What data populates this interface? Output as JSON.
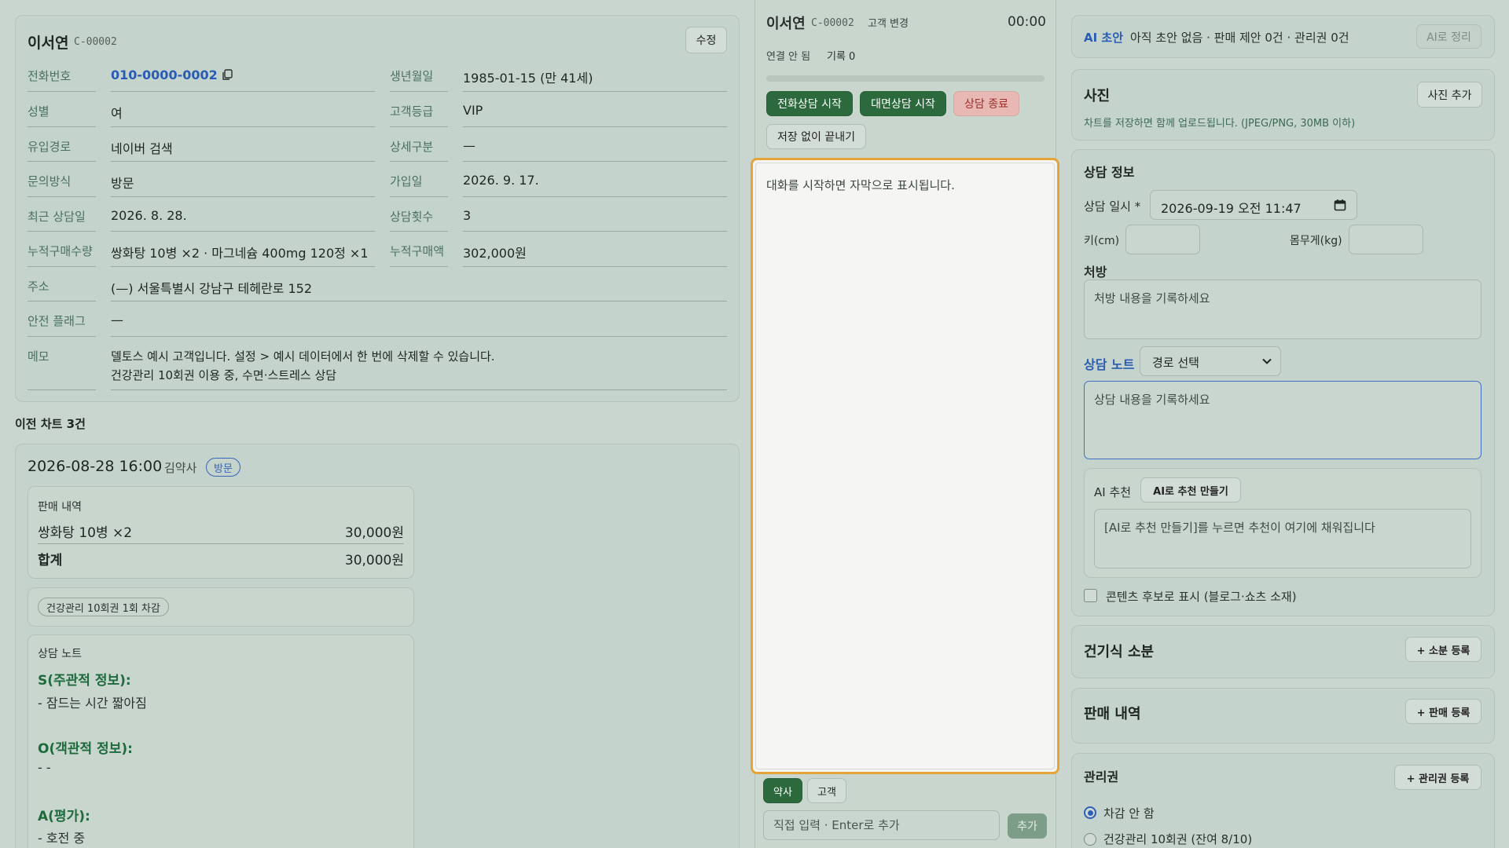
{
  "customer": {
    "name": "이서연",
    "code": "C-00002",
    "edit_label": "수정",
    "fields_left": [
      {
        "label": "전화번호",
        "value": "010-0000-0002"
      },
      {
        "label": "성별",
        "value": "여"
      },
      {
        "label": "유입경로",
        "value": "네이버 검색"
      },
      {
        "label": "문의방식",
        "value": "방문"
      },
      {
        "label": "최근 상담일",
        "value": "2026. 8. 28."
      },
      {
        "label": "누적구매수량",
        "value": "쌍화탕 10병 ×2 · 마그네슘 400mg 120정 ×1"
      }
    ],
    "fields_right": [
      {
        "label": "생년월일",
        "value": "1985-01-15 (만 41세)"
      },
      {
        "label": "고객등급",
        "value": "VIP"
      },
      {
        "label": "상세구분",
        "value": "—"
      },
      {
        "label": "가입일",
        "value": "2026. 9. 17."
      },
      {
        "label": "상담횟수",
        "value": "3"
      },
      {
        "label": "누적구매액",
        "value": "302,000원"
      }
    ],
    "address": {
      "label": "주소",
      "value": "(—) 서울특별시 강남구 테헤란로 152"
    },
    "safety": {
      "label": "안전 플래그",
      "value": "—"
    },
    "memo": {
      "label": "메모",
      "line1": "델토스 예시 고객입니다. 설정 > 예시 데이터에서 한 번에 삭제할 수 있습니다.",
      "line2": "건강관리 10회권 이용 중, 수면·스트레스 상담"
    }
  },
  "history": {
    "title": "이전 차트 3건",
    "date": "2026-08-28 16:00",
    "staff": "김약사",
    "type_badge": "방문",
    "sales": {
      "label": "판매 내역",
      "item": "쌍화탕 10병 ×2",
      "item_price": "30,000원",
      "total_label": "합계",
      "total": "30,000원"
    },
    "voucher_chip": "건강관리 10회권 1회 차감",
    "note": {
      "label": "상담 노트",
      "s_head": "S(주관적 정보):",
      "s_body": "- 잠드는 시간 짧아짐",
      "o_head": "O(객관적 정보):",
      "o_body": "- -",
      "a_head": "A(평가):",
      "a_body": "- 호전 중"
    }
  },
  "session": {
    "name": "이서연",
    "code": "C-00002",
    "change_label": "고객 변경",
    "timer": "00:00",
    "connection": "연결 안 됨",
    "records": "기록 0",
    "phone_start": "전화상담 시작",
    "visit_start": "대면상담 시작",
    "end": "상담 종료",
    "end_no_save": "저장 없이 끝내기",
    "transcript_hint": "대화를 시작하면 자막으로 표시됩니다.",
    "speaker_pharmacist": "약사",
    "speaker_customer": "고객",
    "input_placeholder": "직접 입력 · Enter로 추가",
    "add_label": "추가"
  },
  "ai_draft": {
    "title": "AI 초안",
    "status": "아직 초안 없음 · 판매 제안 0건 · 관리권 0건",
    "button": "AI로 정리"
  },
  "photos": {
    "title": "사진",
    "add_button": "사진 추가",
    "hint": "차트를 저장하면 함께 업로드됩니다. (JPEG/PNG, 30MB 이하)"
  },
  "consult_info": {
    "title": "상담 정보",
    "datetime_label": "상담 일시 *",
    "datetime_value": "2026-09-19 오전 11:47",
    "height_label": "키(cm)",
    "weight_label": "몸무게(kg)",
    "prescription_label": "처방",
    "prescription_placeholder": "처방 내용을 기록하세요",
    "note_label": "상담 노트",
    "route_select": "경로 선택",
    "note_placeholder": "상담 내용을 기록하세요",
    "ai_rec_label": "AI 추천",
    "ai_rec_button": "AI로 추천 만들기",
    "ai_rec_placeholder": "[AI로 추천 만들기]를 누르면 추천이 여기에 채워집니다",
    "content_checkbox": "콘텐츠 후보로 표시 (블로그·쇼츠 소재)"
  },
  "health_food": {
    "title": "건기식 소분",
    "button": "+ 소분 등록"
  },
  "sales_section": {
    "title": "판매 내역",
    "button": "+ 판매 등록"
  },
  "voucher_section": {
    "title": "관리권",
    "button": "+ 관리권 등록",
    "options": [
      "차감 안 함",
      "건강관리 10회권 (잔여 8/10)"
    ]
  },
  "colors": {
    "accent_green": "#2c6a3d",
    "link_blue": "#2b5cb3",
    "highlight_orange": "#e4a43a",
    "danger": "#9a2e28"
  }
}
